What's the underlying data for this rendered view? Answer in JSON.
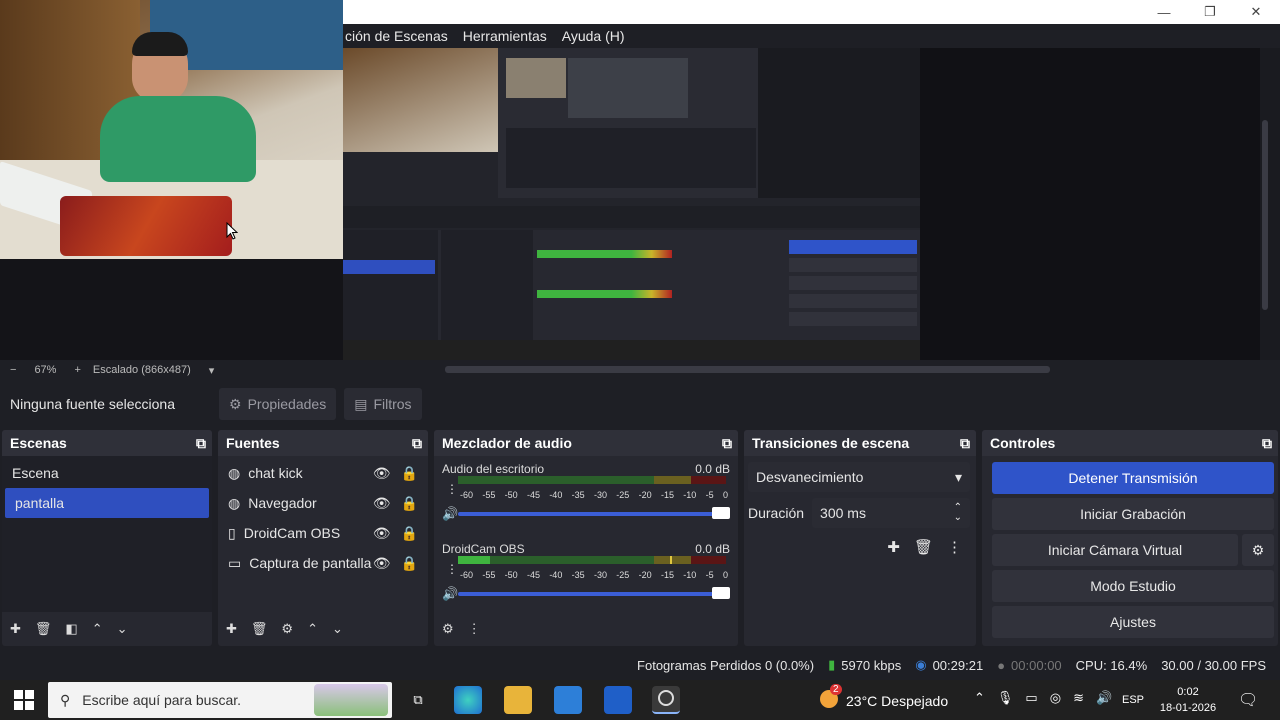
{
  "menu": {
    "items": [
      "ción de Escenas",
      "Herramientas",
      "Ayuda (H)"
    ]
  },
  "zoom": {
    "minus": "−",
    "level": "67%",
    "plus": "+",
    "scale": "Escalado (866x487)"
  },
  "source_bar": {
    "none_selected": "Ninguna fuente selecciona",
    "properties": "Propiedades",
    "filters": "Filtros"
  },
  "scenes": {
    "title": "Escenas",
    "items": [
      "Escena",
      "pantalla"
    ],
    "selected": "pantalla"
  },
  "sources": {
    "title": "Fuentes",
    "items": [
      {
        "label": "chat kick",
        "icon": "browser-globe-icon"
      },
      {
        "label": "Navegador",
        "icon": "browser-globe-icon"
      },
      {
        "label": "DroidCam OBS",
        "icon": "video-device-icon"
      },
      {
        "label": "Captura de pantalla",
        "icon": "monitor-icon"
      }
    ]
  },
  "mixer": {
    "title": "Mezclador de audio",
    "channels": [
      {
        "name": "Audio del escritorio",
        "db": "0.0 dB",
        "level": 0.0
      },
      {
        "name": "DroidCam OBS",
        "db": "0.0 dB",
        "level": 0.0
      }
    ],
    "scale": [
      "-60",
      "-55",
      "-50",
      "-45",
      "-40",
      "-35",
      "-30",
      "-25",
      "-20",
      "-15",
      "-10",
      "-5",
      "0"
    ]
  },
  "transitions": {
    "title": "Transiciones de escena",
    "selected": "Desvanecimiento",
    "duration_label": "Duración",
    "duration_value": "300 ms"
  },
  "controls": {
    "title": "Controles",
    "stop_stream": "Detener Transmisión",
    "start_recording": "Iniciar Grabación",
    "start_virtual_cam": "Iniciar Cámara Virtual",
    "studio_mode": "Modo Estudio",
    "settings": "Ajustes"
  },
  "status": {
    "dropped_frames": "Fotogramas Perdidos 0 (0.0%)",
    "bitrate": "5970 kbps",
    "stream_time": "00:29:21",
    "rec_time": "00:00:00",
    "cpu": "CPU: 16.4%",
    "fps": "30.00 / 30.00 FPS"
  },
  "taskbar": {
    "search_placeholder": "Escribe aquí para buscar.",
    "weather_badge": "2",
    "weather": "23°C  Despejado",
    "lang": "ESP",
    "time": "0:02",
    "date": "18-01-2026"
  },
  "colors": {
    "accent": "#2f54c9",
    "meter_green": "#3fb43f",
    "meter_yellow": "#c8b42a",
    "meter_red": "#b02222"
  }
}
